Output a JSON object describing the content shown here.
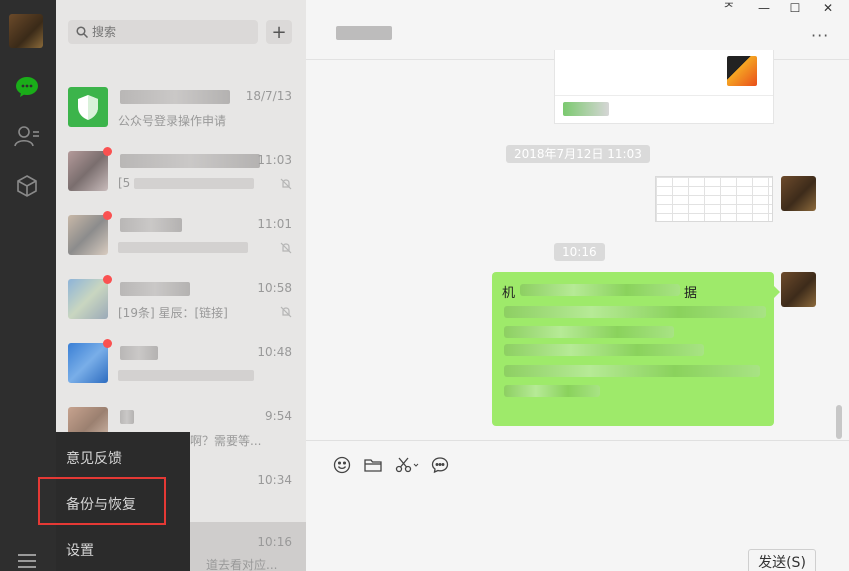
{
  "search": {
    "placeholder": "搜索"
  },
  "add_button": "+",
  "chats": [
    {
      "time": "18/7/13",
      "preview": "公众号登录操作申请"
    },
    {
      "time": "11:03",
      "preview": "[5"
    },
    {
      "time": "11:01",
      "preview": ""
    },
    {
      "time": "10:58",
      "preview": "[19条] 星辰：[链接]"
    },
    {
      "time": "10:48",
      "preview": ""
    },
    {
      "time": "9:54",
      "preview": "啊？需要等..."
    },
    {
      "time": "10:34",
      "preview": ""
    },
    {
      "time": "10:16",
      "preview": "道去看对应..."
    }
  ],
  "menu": {
    "feedback": "意见反馈",
    "backup": "备份与恢复",
    "settings": "设置"
  },
  "window": {
    "pin": "ᅎ",
    "minimize": "—",
    "maximize": "☐",
    "close": "✕",
    "more": "···"
  },
  "timestamps": {
    "first": "2018年7月12日 11:03",
    "second": "10:16"
  },
  "bubble": {
    "first_char": "机",
    "last_char": "据"
  },
  "send_button": "发送(S)",
  "colors": {
    "accent": "#9eea6a",
    "wechat_green": "#1aad19",
    "badge": "#fa5151"
  }
}
